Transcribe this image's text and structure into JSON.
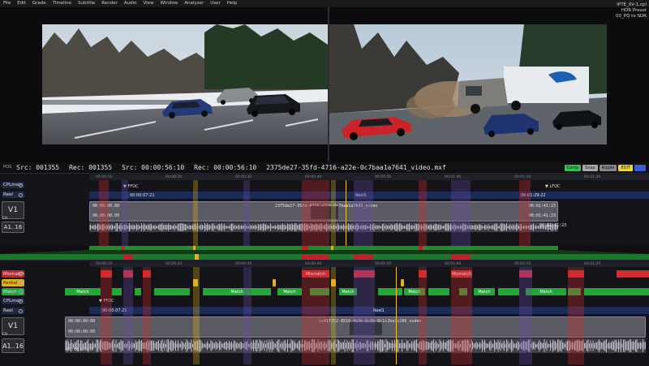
{
  "menu": [
    "File",
    "Edit",
    "Grade",
    "Timeline",
    "Subtitle",
    "Render",
    "Audio",
    "View",
    "Window",
    "Analyzer",
    "User",
    "Help"
  ],
  "corner_info": [
    "IPTE_0V-1.cpl",
    "HDR Preset",
    "00_PQ to SDR"
  ],
  "infobar": {
    "pos_label": "POS",
    "src1": "Src: 001355",
    "rec1": "Rec: 001355",
    "src2": "Src: 00:00:56:10",
    "rec2": "Rec: 00:00:56:10",
    "filename": "2375de27-35fd-4716-a22e-0c7baa1a7641_video.mxf"
  },
  "buttons": [
    {
      "label": "Comp",
      "color": "#3dbb55"
    },
    {
      "label": "Snap",
      "color": "#a9a9a9"
    },
    {
      "label": "Ripple",
      "color": "#8a8a8a"
    },
    {
      "label": "EDIT",
      "color": "#e8d640"
    },
    {
      "label": "",
      "color": "#3a5ad8"
    }
  ],
  "top": {
    "labels": {
      "cplmain": "CPLmain",
      "reel": "Reel",
      "v1": "V1",
      "en": "EN",
      "a1": "A1..16"
    },
    "ffoc": "FFOC",
    "lfoc": "LFOC",
    "tc_in": "00:00:07:21",
    "tc_out": "00:01:29:22",
    "reel": "Reel1",
    "clip_name": "2375de27-35fd-4716-a22e-0c7baa1a7641_video",
    "clip_tc_start": "00.00.00.00",
    "clip_tc_end": "00:01:41:23",
    "ruler": [
      "00:00:10",
      "00:00:20",
      "00:00:30",
      "00:00:40",
      "00:00:50",
      "00:01:00",
      "00:01:10",
      "00:01:20"
    ]
  },
  "bottom": {
    "labels": {
      "mismatch": "Mismatch",
      "partial": "Partial",
      "match": "Match",
      "cplmain": "CPLmain",
      "reel": "Reel",
      "v1": "V1",
      "en": "EN",
      "a1": "A1..16"
    },
    "ffoc": "FFOC",
    "tc_in": "00:00:07:21",
    "reel": "Reel1",
    "clip_name": "cc41f352-8516-4e3e-bc8b-8c1c2ba3c286_video",
    "clip_tc_start": "00:00:00:00",
    "match_label": "Match",
    "mismatch_label": "Mismatch",
    "zero_label": "0",
    "ruler": [
      "00:00:10",
      "00:00:20",
      "00:00:30",
      "00:00:40",
      "00:00:50",
      "00:01:00",
      "00:01:10",
      "00:01:20"
    ]
  },
  "colors": {
    "mismatch": "#d52a30",
    "partial": "#e0b020",
    "match": "#22a836",
    "reel": "#1c2b55",
    "accent": "#3a5ad8"
  }
}
